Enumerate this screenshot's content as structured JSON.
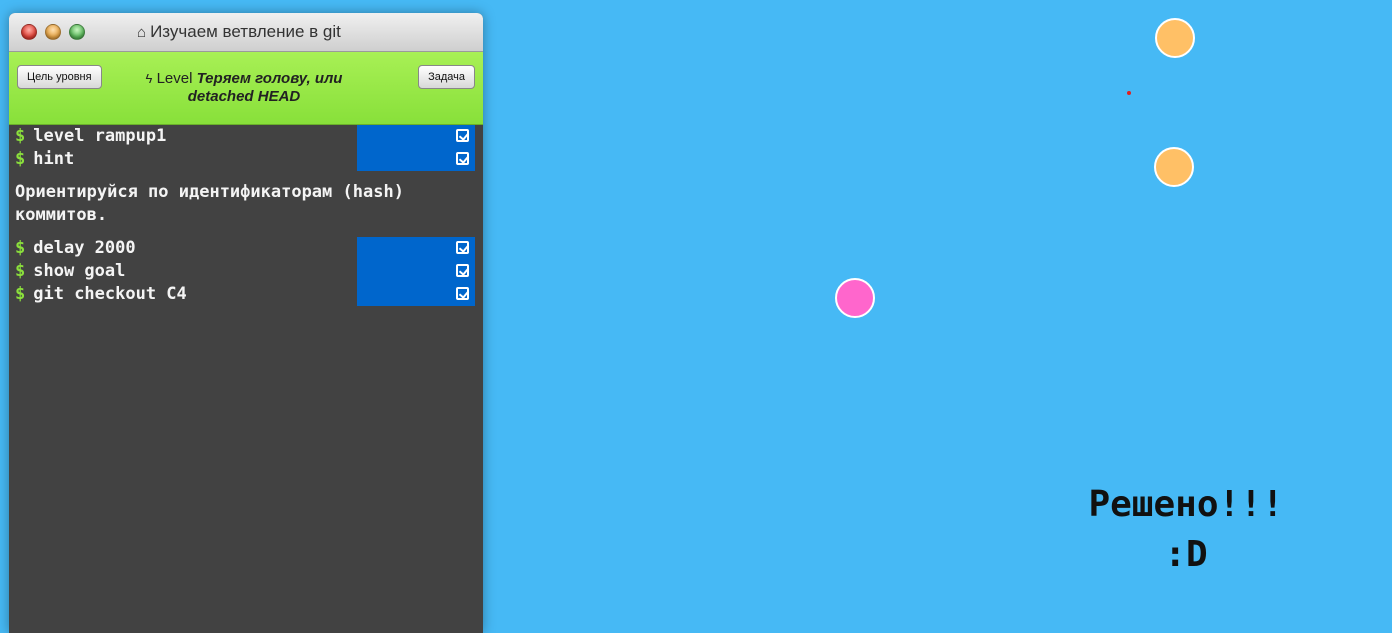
{
  "window": {
    "title": "Изучаем ветвление в git",
    "home_icon": "home-icon"
  },
  "toolbar": {
    "goal_button": "Цель уровня",
    "task_button": "Задача",
    "level_prefix": "Level",
    "level_name": "Теряем голову, или detached HEAD",
    "bolt_icon": "bolt-icon"
  },
  "terminal": {
    "prompt": "$",
    "commands_top": [
      {
        "text": "level rampup1"
      },
      {
        "text": "hint"
      }
    ],
    "hint": "Ориентируйся по идентификаторам (hash) коммитов.",
    "commands_bottom": [
      {
        "text": "delay 2000"
      },
      {
        "text": "show goal"
      },
      {
        "text": "git checkout C4"
      }
    ]
  },
  "visualization": {
    "commit_colors": [
      "#ffc066",
      "#ffc066",
      "#ff66cc"
    ],
    "background": "#46b9f5",
    "solved_text": "Решено!!!",
    "smiley": ":D"
  }
}
